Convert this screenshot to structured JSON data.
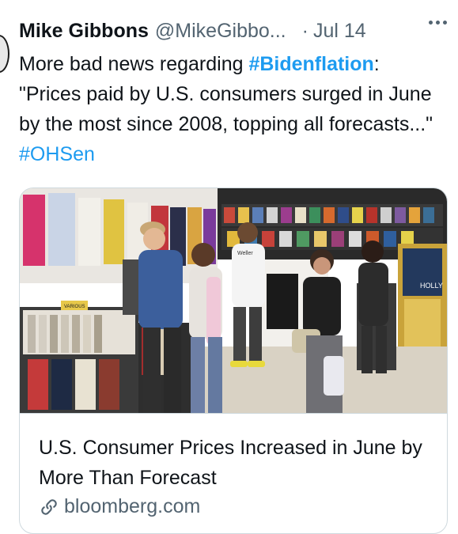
{
  "tweet": {
    "author_name": "Mike Gibbons",
    "author_handle": "@MikeGibbo...",
    "separator": "·",
    "date": "Jul 14",
    "text_intro": "More bad news regarding ",
    "hashtag1": "#Bidenflation",
    "text_quote": ": \"Prices paid by U.S. consumers surged in June by the most since 2008, topping all forecasts...\" ",
    "hashtag2": "#OHSen"
  },
  "card": {
    "title": "U.S. Consumer Prices Increased in June by More Than Forecast",
    "domain": "bloomberg.com",
    "image_signs": {
      "sign1": "VARIOUS",
      "sign2": "Weller",
      "sign3": "HOLLY"
    }
  },
  "colors": {
    "link": "#1d9bf0",
    "secondary": "#536471",
    "border": "#cfd9de",
    "text": "#0f1419"
  },
  "icons": {
    "more": "more-icon",
    "link": "link-icon"
  }
}
